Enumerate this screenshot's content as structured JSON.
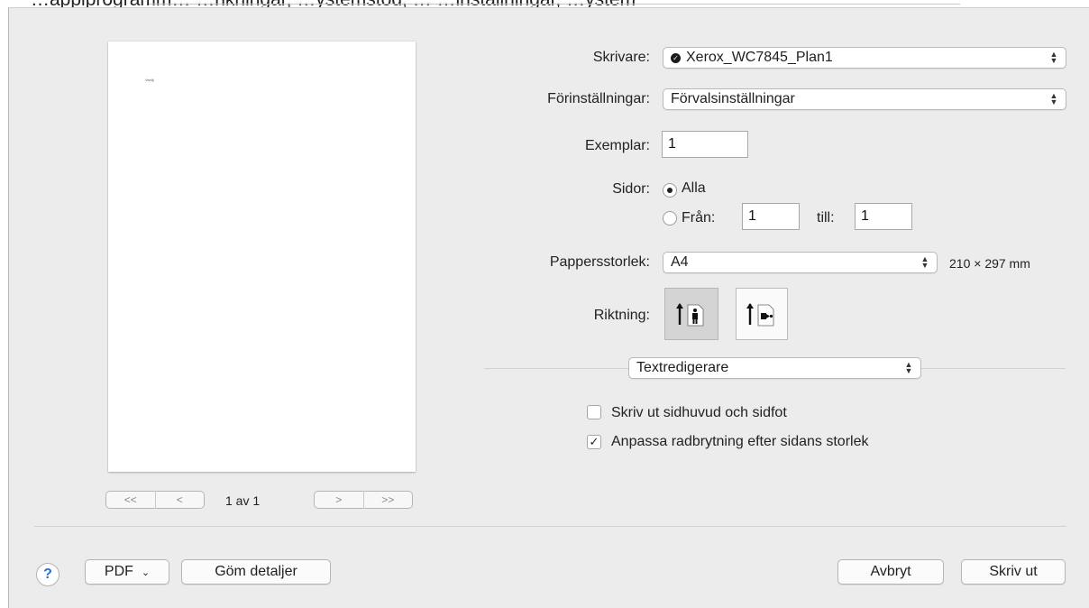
{
  "top_clipped_text": "…applprogramm…  …nkningar, …ystemstöd, … …inställningar, …ystem",
  "preview": {
    "page_mark": "Vanilj",
    "first_label": "<<",
    "prev_label": "<",
    "next_label": ">",
    "last_label": ">>",
    "page_indicator": "1 av 1"
  },
  "printer": {
    "label": "Skrivare:",
    "value": "Xerox_WC7845_Plan1"
  },
  "presets": {
    "label": "Förinställningar:",
    "value": "Förvalsinställningar"
  },
  "copies": {
    "label": "Exemplar:",
    "value": "1"
  },
  "pages": {
    "label": "Sidor:",
    "all_label": "Alla",
    "from_label": "Från:",
    "from_value": "1",
    "to_label": "till:",
    "to_value": "1",
    "selected": "Alla"
  },
  "paper_size": {
    "label": "Pappersstorlek:",
    "value": "A4",
    "dimensions": "210 × 297 mm"
  },
  "orientation": {
    "label": "Riktning:",
    "selected": "portrait"
  },
  "app_section": {
    "value": "Textredigerare"
  },
  "options": [
    {
      "label": "Skriv ut sidhuvud och sidfot",
      "checked": false
    },
    {
      "label": "Anpassa radbrytning efter sidans storlek",
      "checked": true
    }
  ],
  "footer": {
    "help": "?",
    "pdf_label": "PDF",
    "hide_details_label": "Göm detaljer",
    "cancel_label": "Avbryt",
    "print_label": "Skriv ut"
  },
  "colors": {
    "dialog_bg": "#ececec",
    "help_blue": "#2b6fd6",
    "selected_orientation": "#d4d4d4"
  }
}
